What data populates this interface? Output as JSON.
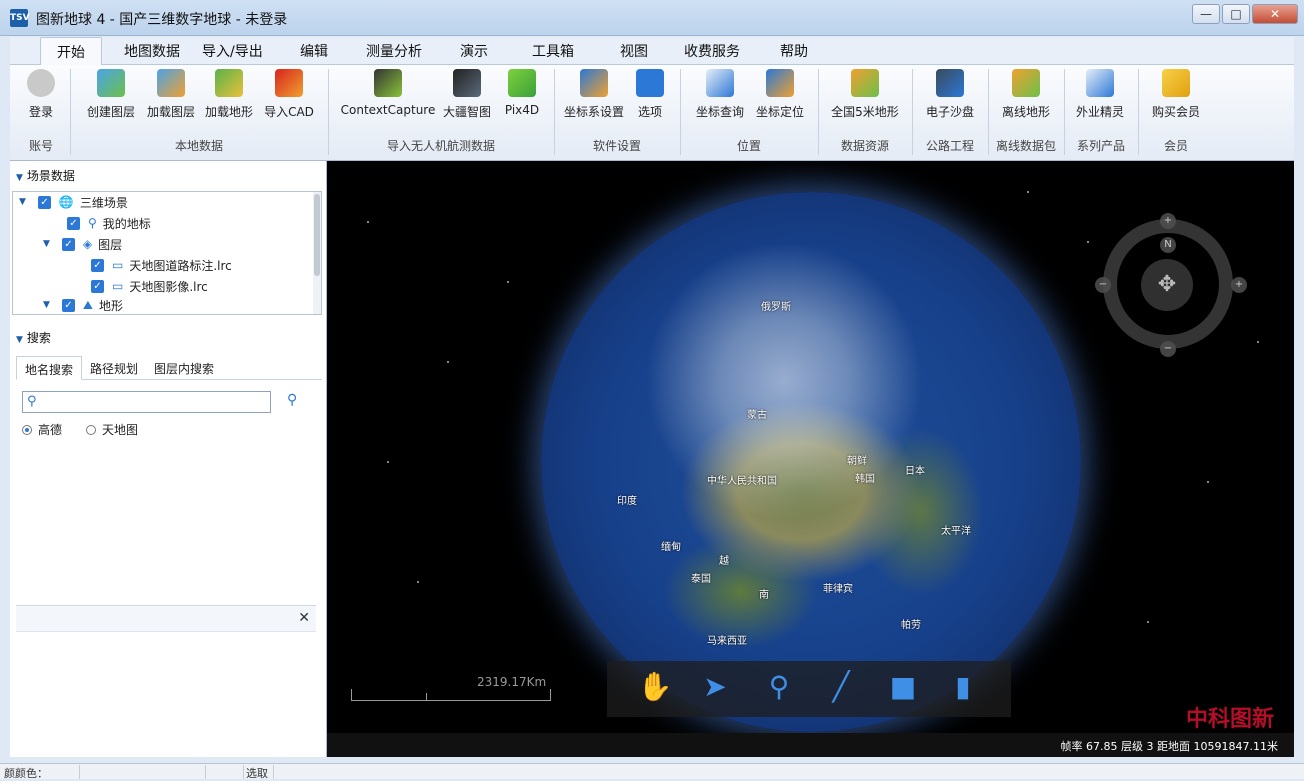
{
  "window": {
    "title": "图新地球 4 - 国产三维数字地球 - 未登录",
    "icon_text": "TSV",
    "minimize": "—",
    "maximize": "□",
    "close": "✕"
  },
  "menu": [
    "开始",
    "地图数据",
    "导入/导出",
    "编辑",
    "测量分析",
    "演示",
    "工具箱",
    "视图",
    "收费服务",
    "帮助"
  ],
  "ribbon": {
    "buttons": [
      {
        "label": "登录",
        "icon": "user-avatar-icon"
      },
      {
        "label": "创建图层",
        "icon": "create-layer-icon"
      },
      {
        "label": "加载图层",
        "icon": "load-layer-icon"
      },
      {
        "label": "加载地形",
        "icon": "load-terrain-icon"
      },
      {
        "label": "导入CAD",
        "icon": "import-cad-icon"
      },
      {
        "label": "ContextCapture",
        "icon": "contextcapture-icon"
      },
      {
        "label": "大疆智图",
        "icon": "dji-terra-icon"
      },
      {
        "label": "Pix4D",
        "icon": "pix4d-icon"
      },
      {
        "label": "坐标系设置",
        "icon": "crs-settings-icon"
      },
      {
        "label": "选项",
        "icon": "options-gear-icon"
      },
      {
        "label": "坐标查询",
        "icon": "coord-query-icon"
      },
      {
        "label": "坐标定位",
        "icon": "coord-locate-icon"
      },
      {
        "label": "全国5米地形",
        "icon": "terrain-5m-icon"
      },
      {
        "label": "电子沙盘",
        "icon": "sand-table-icon"
      },
      {
        "label": "离线地形",
        "icon": "offline-terrain-icon"
      },
      {
        "label": "外业精灵",
        "icon": "field-app-icon"
      },
      {
        "label": "购买会员",
        "icon": "vip-icon"
      }
    ],
    "groups": [
      "账号",
      "本地数据",
      "导入无人机航测数据",
      "软件设置",
      "位置",
      "数据资源",
      "公路工程",
      "离线数据包",
      "系列产品",
      "会员"
    ]
  },
  "left_panel": {
    "scene_header": "场景数据",
    "tree": [
      {
        "label": "三维场景",
        "icon": "globe-icon"
      },
      {
        "label": "我的地标",
        "icon": "pin-icon"
      },
      {
        "label": "图层",
        "icon": "layers-icon"
      },
      {
        "label": "天地图道路标注.lrc",
        "icon": "monitor-icon"
      },
      {
        "label": "天地图影像.lrc",
        "icon": "monitor-icon"
      },
      {
        "label": "地形",
        "icon": "terrain-icon"
      }
    ],
    "search_header": "搜索",
    "search_tabs": [
      "地名搜索",
      "路径规划",
      "图层内搜索"
    ],
    "search_value": "",
    "radios": [
      {
        "label": "高德",
        "selected": true
      },
      {
        "label": "天地图",
        "selected": false
      }
    ],
    "info_close": "✕"
  },
  "viewport": {
    "labels": [
      {
        "text": "中华人民共和国"
      },
      {
        "text": "日本"
      },
      {
        "text": "韩国"
      },
      {
        "text": "朝鲜"
      },
      {
        "text": "蒙古"
      },
      {
        "text": "俄罗斯"
      },
      {
        "text": "印度"
      },
      {
        "text": "缅甸"
      },
      {
        "text": "泰国"
      },
      {
        "text": "越"
      },
      {
        "text": "南"
      },
      {
        "text": "菲律宾"
      },
      {
        "text": "马来西亚"
      },
      {
        "text": "太平洋"
      },
      {
        "text": "帕劳"
      }
    ],
    "scale_text": "2319.17Km",
    "status": "帧率 67.85  层级 3  距地面 10591847.11米",
    "watermark": "中科图新",
    "tools": [
      "hand-pan-icon",
      "pointer-icon",
      "placemark-pin-icon",
      "line-draw-icon",
      "polygon-draw-icon",
      "measure-chart-icon"
    ]
  },
  "statusbar": {
    "cells": [
      "颜颜色：",
      "",
      "",
      "选取"
    ]
  }
}
